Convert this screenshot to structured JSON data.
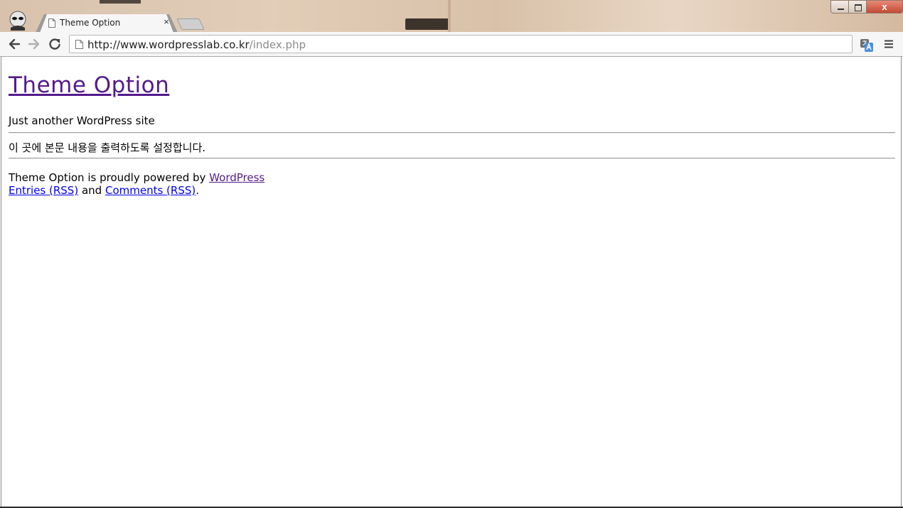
{
  "browser": {
    "tab_title": "Theme Option",
    "tab_close_glyph": "×",
    "url_host": "http://www.wordpresslab.co.kr",
    "url_path": "/index.php",
    "window_close_glyph": "x"
  },
  "page": {
    "site_title": "Theme Option",
    "tagline": "Just another WordPress site",
    "body_text": "이 곳에 본문 내용을 출력하도록 설정합니다.",
    "footer": {
      "powered_prefix": "Theme Option is proudly powered by",
      "wordpress_link": "WordPress",
      "entries_link": "Entries (RSS)",
      "and_text": "and",
      "comments_link": "Comments (RSS)",
      "period": "."
    }
  },
  "colors": {
    "visited_link": "#551a8b",
    "link": "#0000ee"
  },
  "icons": [
    "avatar-icon",
    "page-icon",
    "close-icon",
    "back-arrow-icon",
    "forward-arrow-icon",
    "reload-icon",
    "translate-icon",
    "menu-icon"
  ]
}
